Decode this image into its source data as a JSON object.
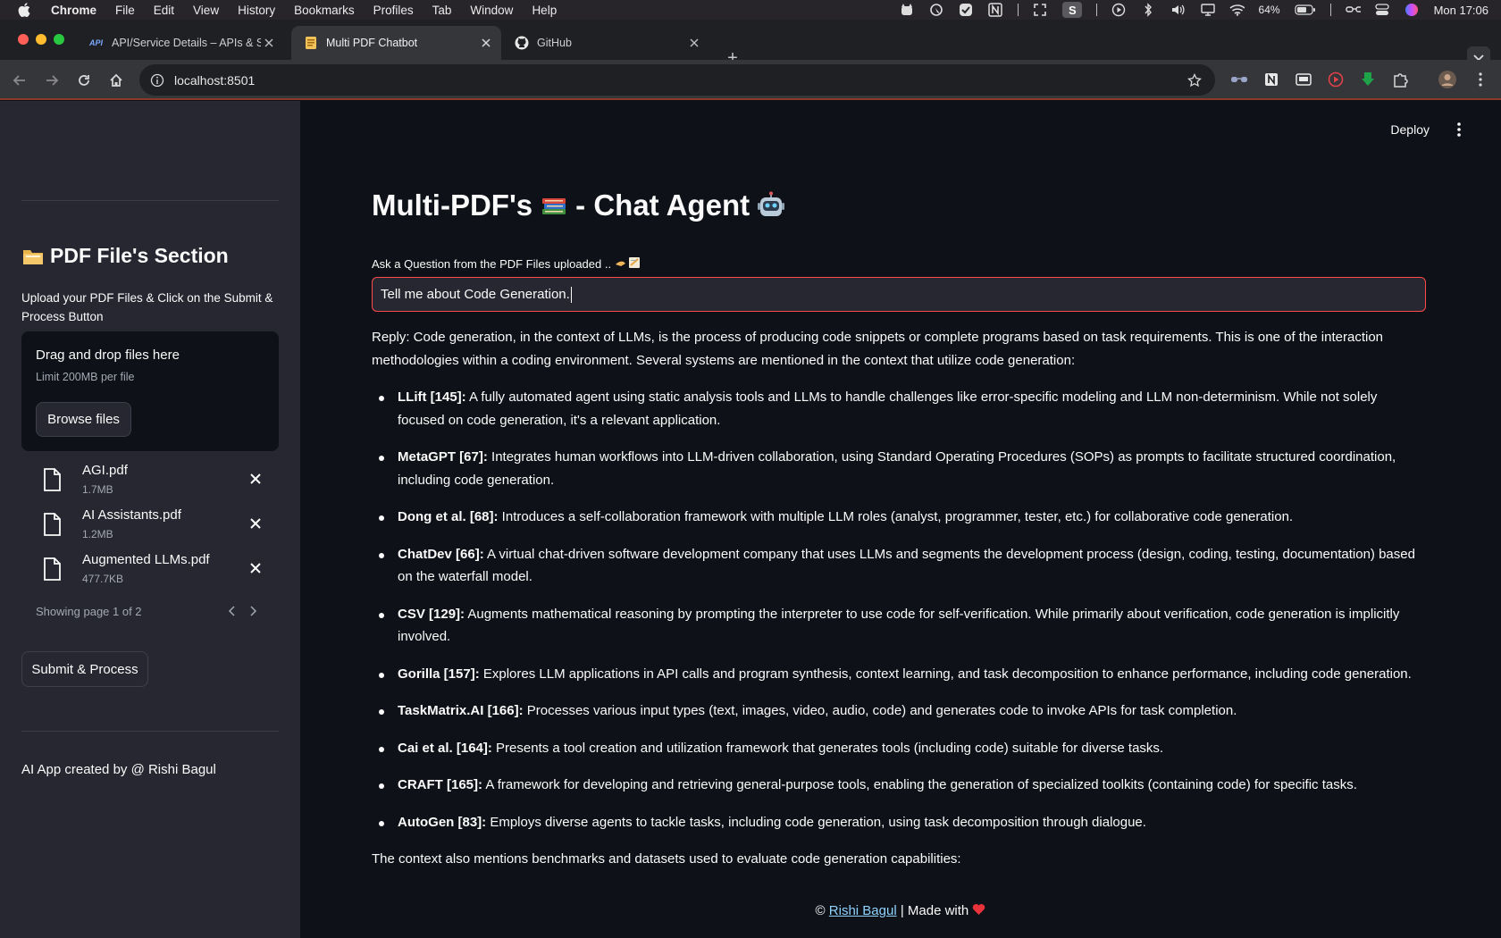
{
  "menubar": {
    "app_name": "Chrome",
    "items": [
      "File",
      "Edit",
      "View",
      "History",
      "Bookmarks",
      "Profiles",
      "Tab",
      "Window",
      "Help"
    ],
    "battery": "64%",
    "clock": "Mon 17:06"
  },
  "tabs": [
    {
      "title": "API/Service Details – APIs & S",
      "favicon": "API",
      "active": false
    },
    {
      "title": "Multi PDF Chatbot",
      "active": true
    },
    {
      "title": "GitHub",
      "active": false
    }
  ],
  "toolbar": {
    "url": "localhost:8501"
  },
  "sidebar": {
    "header": "PDF File's Section",
    "description": "Upload your PDF Files & Click on the Submit & Process Button",
    "dropzone": {
      "title": "Drag and drop files here",
      "limit": "Limit 200MB per file",
      "browse_label": "Browse files"
    },
    "files": [
      {
        "name": "AGI.pdf",
        "size": "1.7MB"
      },
      {
        "name": "AI Assistants.pdf",
        "size": "1.2MB"
      },
      {
        "name": "Augmented LLMs.pdf",
        "size": "477.7KB"
      }
    ],
    "pager_text": "Showing page 1 of 2",
    "submit_label": "Submit & Process",
    "credit": "AI App created by @ Rishi Bagul"
  },
  "main": {
    "deploy_label": "Deploy",
    "title_part1": "Multi-PDF's",
    "title_part2": "- Chat Agent",
    "question_label": "Ask a Question from the PDF Files uploaded ..",
    "question_value": "Tell me about Code Generation.",
    "reply_intro": "Reply: Code generation, in the context of LLMs, is the process of producing code snippets or complete programs based on task requirements. This is one of the interaction methodologies within a coding environment. Several systems are mentioned in the context that utilize code generation:",
    "reply_items": [
      {
        "term": "LLift [145]:",
        "text": " A fully automated agent using static analysis tools and LLMs to handle challenges like error-specific modeling and LLM non-determinism. While not solely focused on code generation, it's a relevant application."
      },
      {
        "term": "MetaGPT [67]:",
        "text": " Integrates human workflows into LLM-driven collaboration, using Standard Operating Procedures (SOPs) as prompts to facilitate structured coordination, including code generation."
      },
      {
        "term": "Dong et al. [68]:",
        "text": " Introduces a self-collaboration framework with multiple LLM roles (analyst, programmer, tester, etc.) for collaborative code generation."
      },
      {
        "term": "ChatDev [66]:",
        "text": " A virtual chat-driven software development company that uses LLMs and segments the development process (design, coding, testing, documentation) based on the waterfall model."
      },
      {
        "term": "CSV [129]:",
        "text": " Augments mathematical reasoning by prompting the interpreter to use code for self-verification. While primarily about verification, code generation is implicitly involved."
      },
      {
        "term": "Gorilla [157]:",
        "text": " Explores LLM applications in API calls and program synthesis, context learning, and task decomposition to enhance performance, including code generation."
      },
      {
        "term": "TaskMatrix.AI [166]:",
        "text": " Processes various input types (text, images, video, audio, code) and generates code to invoke APIs for task completion."
      },
      {
        "term": "Cai et al. [164]:",
        "text": " Presents a tool creation and utilization framework that generates tools (including code) suitable for diverse tasks."
      },
      {
        "term": "CRAFT [165]:",
        "text": " A framework for developing and retrieving general-purpose tools, enabling the generation of specialized toolkits (containing code) for specific tasks."
      },
      {
        "term": "AutoGen [83]:",
        "text": " Employs diverse agents to tackle tasks, including code generation, using task decomposition through dialogue."
      }
    ],
    "closing": "The context also mentions benchmarks and datasets used to evaluate code generation capabilities:",
    "footer_prefix": "©",
    "footer_link": "Rishi Bagul",
    "footer_suffix": "| Made with"
  },
  "colors": {
    "sidebar_bg": "#262730",
    "main_bg": "#0e1117",
    "input_border": "#ff4b4b",
    "link": "#8fd3ff"
  }
}
